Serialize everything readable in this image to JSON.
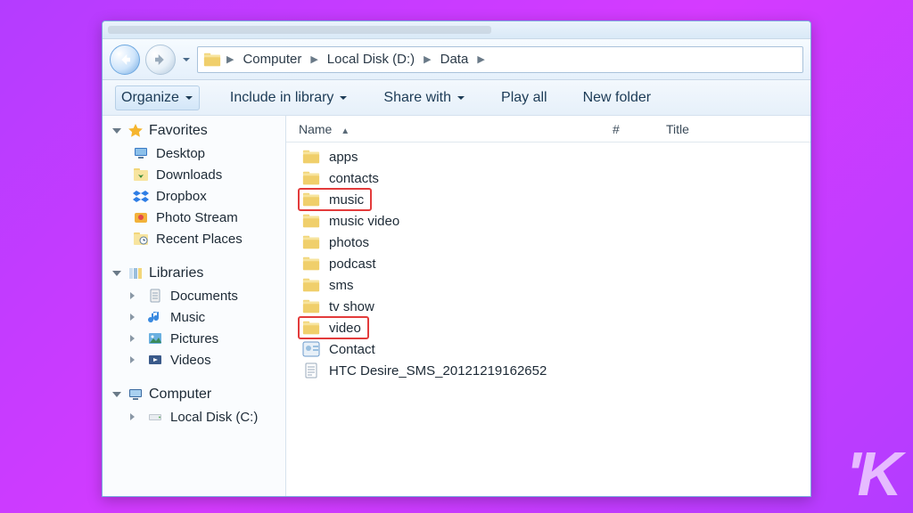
{
  "breadcrumbs": [
    "Computer",
    "Local Disk (D:)",
    "Data"
  ],
  "toolbar": {
    "organize": "Organize",
    "include": "Include in library",
    "share": "Share with",
    "playall": "Play all",
    "newfolder": "New folder"
  },
  "columns": {
    "name": "Name",
    "num": "#",
    "title": "Title"
  },
  "sidebar": {
    "favorites": {
      "label": "Favorites",
      "items": [
        {
          "label": "Desktop",
          "icon": "desktop"
        },
        {
          "label": "Downloads",
          "icon": "downloads"
        },
        {
          "label": "Dropbox",
          "icon": "dropbox"
        },
        {
          "label": "Photo Stream",
          "icon": "photostream"
        },
        {
          "label": "Recent Places",
          "icon": "recent"
        }
      ]
    },
    "libraries": {
      "label": "Libraries",
      "items": [
        {
          "label": "Documents",
          "icon": "documents"
        },
        {
          "label": "Music",
          "icon": "music"
        },
        {
          "label": "Pictures",
          "icon": "pictures"
        },
        {
          "label": "Videos",
          "icon": "videos"
        }
      ]
    },
    "computer": {
      "label": "Computer",
      "items": [
        {
          "label": "Local Disk (C:)",
          "icon": "drive"
        }
      ]
    }
  },
  "items": [
    {
      "name": "apps",
      "type": "folder",
      "highlight": false
    },
    {
      "name": "contacts",
      "type": "folder",
      "highlight": false
    },
    {
      "name": "music",
      "type": "folder",
      "highlight": true
    },
    {
      "name": "music video",
      "type": "folder",
      "highlight": false
    },
    {
      "name": "photos",
      "type": "folder",
      "highlight": false
    },
    {
      "name": "podcast",
      "type": "folder",
      "highlight": false
    },
    {
      "name": "sms",
      "type": "folder",
      "highlight": false
    },
    {
      "name": "tv show",
      "type": "folder",
      "highlight": false
    },
    {
      "name": "video",
      "type": "folder",
      "highlight": true
    },
    {
      "name": "Contact",
      "type": "contact",
      "highlight": false
    },
    {
      "name": "HTC Desire_SMS_20121219162652",
      "type": "file",
      "highlight": false
    }
  ],
  "watermark": "'K"
}
